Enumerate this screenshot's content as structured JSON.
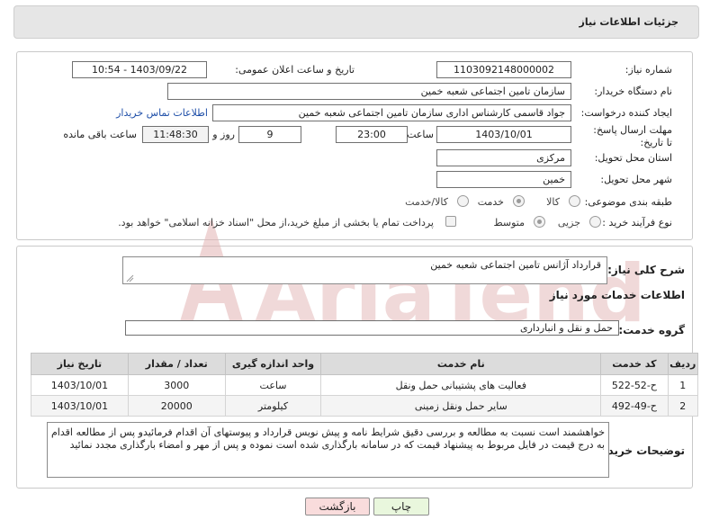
{
  "header": {
    "title": "جزئیات اطلاعات نیاز"
  },
  "form": {
    "need_number_label": "شماره نیاز:",
    "need_number": "1103092148000002",
    "announce_label": "تاریخ و ساعت اعلان عمومی:",
    "announce_value": "1403/09/22 - 10:54",
    "buyer_org_label": "نام دستگاه خریدار:",
    "buyer_org": "سازمان تامین اجتماعی شعبه خمین",
    "creator_label": "ایجاد کننده درخواست:",
    "creator": "جواد قاسمی کارشناس اداری سازمان تامین اجتماعی شعبه خمین",
    "contact_link": "اطلاعات تماس خریدار",
    "deadline_label": "مهلت ارسال پاسخ: تا تاریخ:",
    "deadline_date": "1403/10/01",
    "time_label": "ساعت",
    "deadline_time": "23:00",
    "days_value": "9",
    "days_label": "روز و",
    "remaining_time": "11:48:30",
    "remaining_label": "ساعت باقی مانده",
    "province_label": "استان محل تحویل:",
    "province": "مرکزی",
    "city_label": "شهر محل تحویل:",
    "city": "خمین",
    "category_label": "طبقه بندی موضوعی:",
    "category_options": [
      "کالا",
      "خدمت",
      "کالا/خدمت"
    ],
    "category_selected": "خدمت",
    "process_label": "نوع فرآیند خرید :",
    "process_options": [
      "جزیی",
      "متوسط"
    ],
    "process_selected": "متوسط",
    "payment_note": "پرداخت تمام یا بخشی از مبلغ خرید،از محل \"اسناد خزانه اسلامی\" خواهد بود."
  },
  "summary": {
    "label": "شرح کلی نیاز:",
    "value": "قرارداد آژانس تامین اجتماعی شعبه خمین"
  },
  "services": {
    "section_title": "اطلاعات خدمات مورد نیاز",
    "group_label": "گروه خدمت:",
    "group_value": "حمل و نقل و انبارداری",
    "columns": [
      "ردیف",
      "کد خدمت",
      "نام خدمت",
      "واحد اندازه گیری",
      "تعداد / مقدار",
      "تاریخ نیاز"
    ],
    "rows": [
      {
        "index": "1",
        "code": "ح-52-522",
        "name": "فعالیت های پشتیبانی حمل ونقل",
        "unit": "ساعت",
        "qty": "3000",
        "date": "1403/10/01"
      },
      {
        "index": "2",
        "code": "ح-49-492",
        "name": "سایر حمل ونقل زمینی",
        "unit": "کیلومتر",
        "qty": "20000",
        "date": "1403/10/01"
      }
    ]
  },
  "buyer_notes": {
    "label": "توضیحات خریدار:",
    "text": "خواهشمند است نسبت به مطالعه و بررسی دقیق شرایط نامه و پیش نویس قرارداد و پیوستهای آن اقدام فرمائیدو پس از مطالعه اقدام به درج قیمت در فایل مربوط به پیشنهاد قیمت که در سامانه بارگذاری شده است نموده و پس از مهر و امضاء بارگذاری مجدد نمائید"
  },
  "buttons": {
    "print": "چاپ",
    "back": "بازگشت"
  },
  "watermark": {
    "brand_text": "AriaTender.neT"
  },
  "colors": {
    "link": "#1f4fa8",
    "header_bg": "#e6e6e6",
    "print_button": "#e9f7dd",
    "back_button": "#f9dcdc",
    "watermark": "#e3b4b4"
  }
}
